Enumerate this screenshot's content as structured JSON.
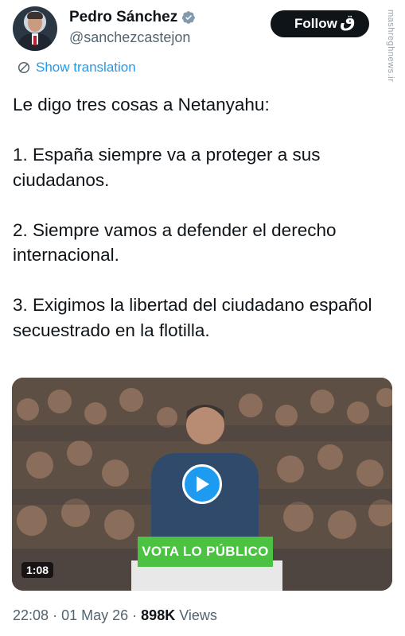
{
  "author": {
    "name": "Pedro Sánchez",
    "handle": "@sanchezcastejon"
  },
  "follow_label": "Follow",
  "watermark": {
    "logo": "ق",
    "text": "mashreghnews.ir"
  },
  "translate_label": "Show translation",
  "tweet": {
    "paragraphs": [
      "Le digo tres cosas a Netanyahu:",
      "1. España siempre va a proteger a sus ciudadanos.",
      "2. Siempre vamos a defender el derecho internacional.",
      "3. Exigimos la libertad del ciudadano español secuestrado en la flotilla."
    ]
  },
  "video": {
    "duration": "1:08",
    "sign_text": "VOTA LO PÚBLICO"
  },
  "meta": {
    "time": "22:08",
    "date": "01 May 26",
    "views_count": "898K",
    "views_label": "Views"
  },
  "colors": {
    "accent": "#1d9bf0",
    "text": "#0f1419",
    "secondary": "#536471",
    "sign_green": "#4cc242"
  }
}
